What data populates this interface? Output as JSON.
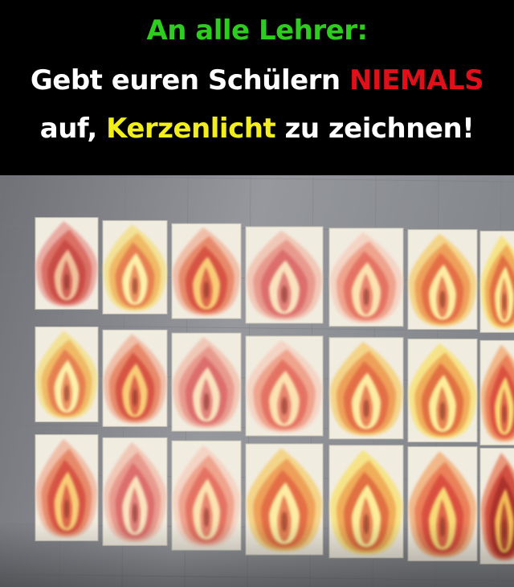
{
  "caption": {
    "line1": {
      "text": "An alle Lehrer:",
      "color": "#2ecc1e"
    },
    "line2": [
      {
        "text": "Gebt euren Schülern ",
        "color": "#ffffff"
      },
      {
        "text": "NIEMALS",
        "color": "#e0101a"
      }
    ],
    "line3": [
      {
        "text": "auf, ",
        "color": "#ffffff"
      },
      {
        "text": "Kerzenlicht",
        "color": "#f2ee1a"
      },
      {
        "text": " zu zeichnen!",
        "color": "#ffffff"
      }
    ]
  },
  "photo": {
    "subject": "wall-of-candle-flame-paintings",
    "rows": 3,
    "columns": 7,
    "wall_color": "#8f9196",
    "paper_color": "#f1ece0"
  }
}
